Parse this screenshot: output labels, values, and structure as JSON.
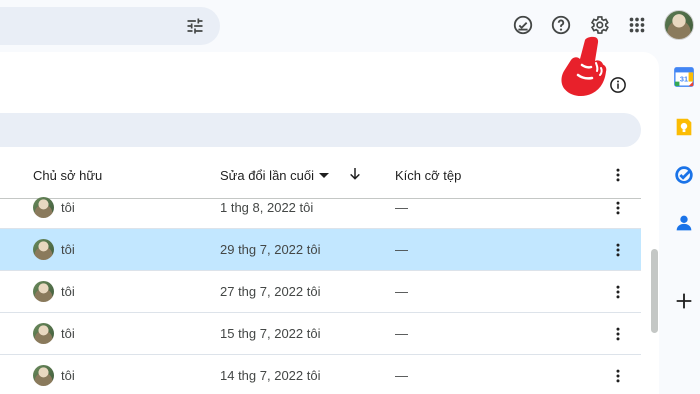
{
  "colors": {
    "selected_row": "#c2e7ff",
    "accent_hand": "#e8212b"
  },
  "icons": {
    "search_bar": "tune-icon",
    "top": [
      "ready-for-offline-icon",
      "help-icon",
      "settings-icon",
      "apps-grid-icon"
    ],
    "side": [
      "google-calendar-icon",
      "google-keep-icon",
      "google-tasks-icon",
      "google-contacts-icon",
      "add-icon"
    ],
    "info": "info-icon"
  },
  "table": {
    "headers": {
      "owner": "Chủ sở hữu",
      "modified": "Sửa đổi lần cuối",
      "size": "Kích cỡ tệp"
    },
    "rows": [
      {
        "owner": "tôi",
        "modified": "1 thg 8, 2022 tôi",
        "size": "—",
        "selected": false
      },
      {
        "owner": "tôi",
        "modified": "29 thg 7, 2022 tôi",
        "size": "—",
        "selected": true
      },
      {
        "owner": "tôi",
        "modified": "27 thg 7, 2022 tôi",
        "size": "—",
        "selected": false
      },
      {
        "owner": "tôi",
        "modified": "15 thg 7, 2022 tôi",
        "size": "—",
        "selected": false
      },
      {
        "owner": "tôi",
        "modified": "14 thg 7, 2022 tôi",
        "size": "—",
        "selected": false
      }
    ]
  }
}
